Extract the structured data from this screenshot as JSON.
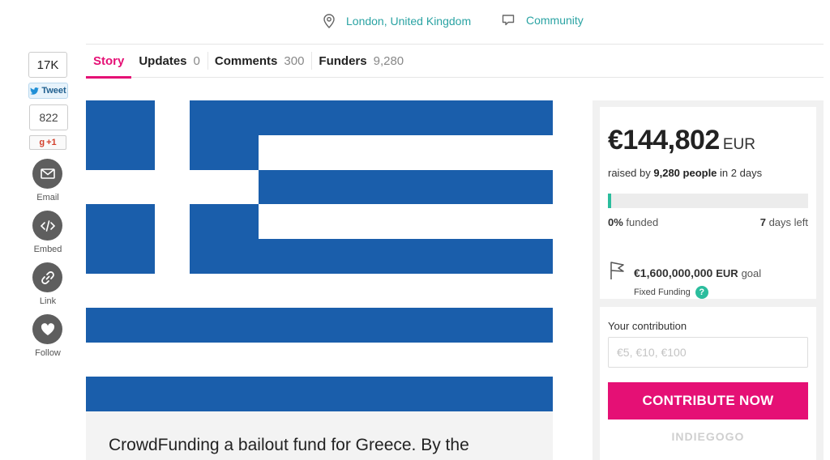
{
  "header": {
    "location": "London, United Kingdom",
    "category": "Community"
  },
  "tabs": [
    {
      "label": "Story",
      "count": ""
    },
    {
      "label": "Updates",
      "count": "0"
    },
    {
      "label": "Comments",
      "count": "300"
    },
    {
      "label": "Funders",
      "count": "9,280"
    }
  ],
  "social": {
    "tweet_count": "17K",
    "tweet_label": "Tweet",
    "gplus_count": "822",
    "gplus_label": "+1",
    "email_label": "Email",
    "embed_label": "Embed",
    "link_label": "Link",
    "follow_label": "Follow"
  },
  "campaign": {
    "flag_colors": {
      "blue": "#1a5eab",
      "white": "#ffffff"
    },
    "story_intro": "CrowdFunding a bailout fund for Greece. By the"
  },
  "funding": {
    "amount": "€144,802",
    "currency": "EUR",
    "raised_prefix": "raised by",
    "people": "9,280 people",
    "raised_suffix": "in 2 days",
    "progress_fraction": 0.0001,
    "funded_pct": "0%",
    "funded_label": "funded",
    "days_left_num": "7",
    "days_left_label": "days left",
    "goal_amount": "€1,600,000,000",
    "goal_currency": "EUR",
    "goal_label": "goal",
    "funding_type": "Fixed Funding",
    "help_icon": "?"
  },
  "contribution": {
    "label": "Your contribution",
    "placeholder": "€5, €10, €100",
    "button": "CONTRIBUTE NOW",
    "brand": "INDIEGOGO"
  },
  "colors": {
    "accent": "#e51075",
    "teal": "#2aa3a3",
    "progress": "#2bbd9d"
  }
}
